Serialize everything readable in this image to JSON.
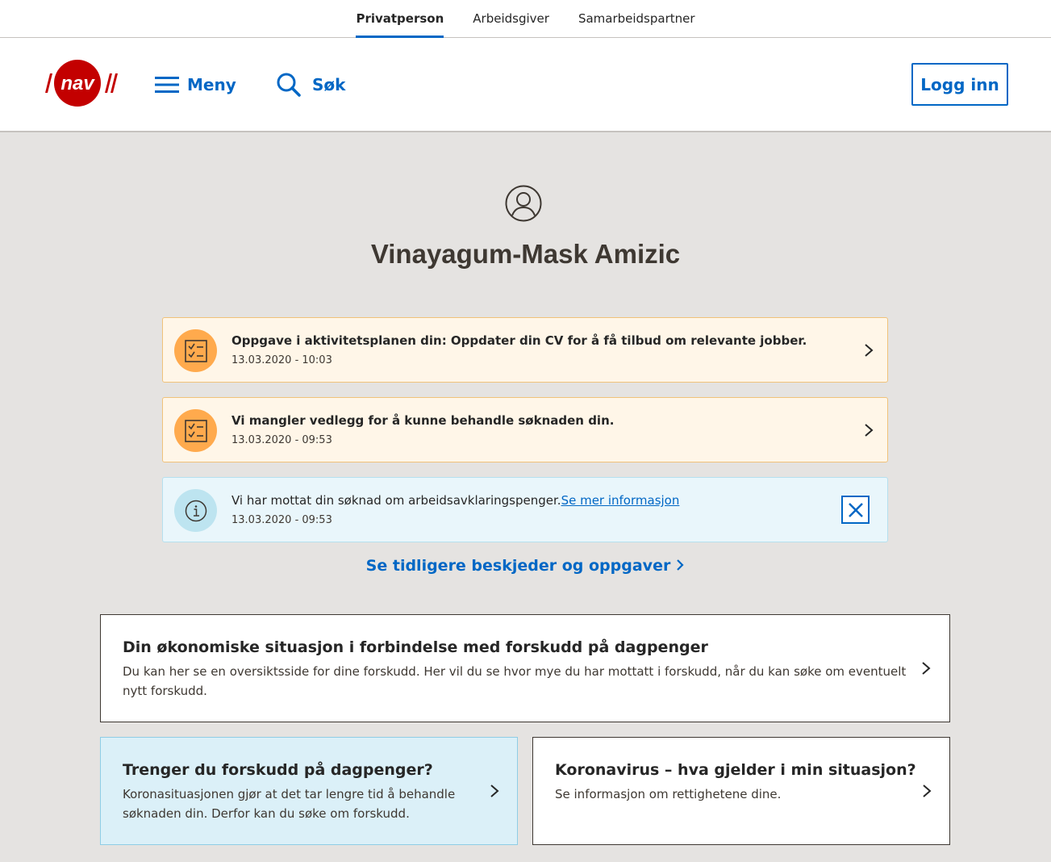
{
  "context_bar": {
    "tabs": [
      {
        "label": "Privatperson",
        "active": true
      },
      {
        "label": "Arbeidsgiver",
        "active": false
      },
      {
        "label": "Samarbeidspartner",
        "active": false
      }
    ]
  },
  "header": {
    "logo_text": "nav",
    "menu_label": "Meny",
    "search_label": "Søk",
    "login_label": "Logg inn"
  },
  "profile": {
    "icon": "user-circle-icon",
    "name": "Vinayagum-Mask Amizic"
  },
  "notices": [
    {
      "type": "task",
      "icon": "checklist-icon",
      "title": "Oppgave i aktivitetsplanen din: Oppdater din CV for å få tilbud om relevante jobber.",
      "date": "13.03.2020 - 10:03"
    },
    {
      "type": "task",
      "icon": "checklist-icon",
      "title": "Vi mangler vedlegg for å kunne behandle søknaden din.",
      "date": "13.03.2020 - 09:53"
    },
    {
      "type": "info",
      "icon": "info-icon",
      "title": "Vi har mottat din søknad om arbeidsavklaringspenger.",
      "link_label": "Se mer informasjon",
      "date": "13.03.2020 - 09:53"
    }
  ],
  "earlier_link": "Se tidligere beskjeder og oppgaver",
  "cards": [
    {
      "title": "Din økonomiske situasjon i forbindelse med forskudd på dagpenger",
      "text": "Du kan her se en oversiktsside for dine forskudd. Her vil du se hvor mye du har mottatt i forskudd, når du kan søke om eventuelt nytt forskudd."
    },
    {
      "title": "Trenger du forskudd på dagpenger?",
      "text": "Koronasituasjonen gjør at det tar lengre tid å behandle søknaden din. Derfor kan du søke om forskudd."
    },
    {
      "title": "Koronavirus – hva gjelder i min situasjon?",
      "text": "Se informasjon om rettighetene dine."
    }
  ],
  "colors": {
    "accent": "#0067c5",
    "nav_red": "#c30000",
    "task_bg": "#fff6e8",
    "task_icon_bg": "#ffaa4d",
    "info_bg": "#e9f6fb",
    "info_icon_bg": "#bde4f0",
    "page_bg": "#e5e3e1"
  }
}
